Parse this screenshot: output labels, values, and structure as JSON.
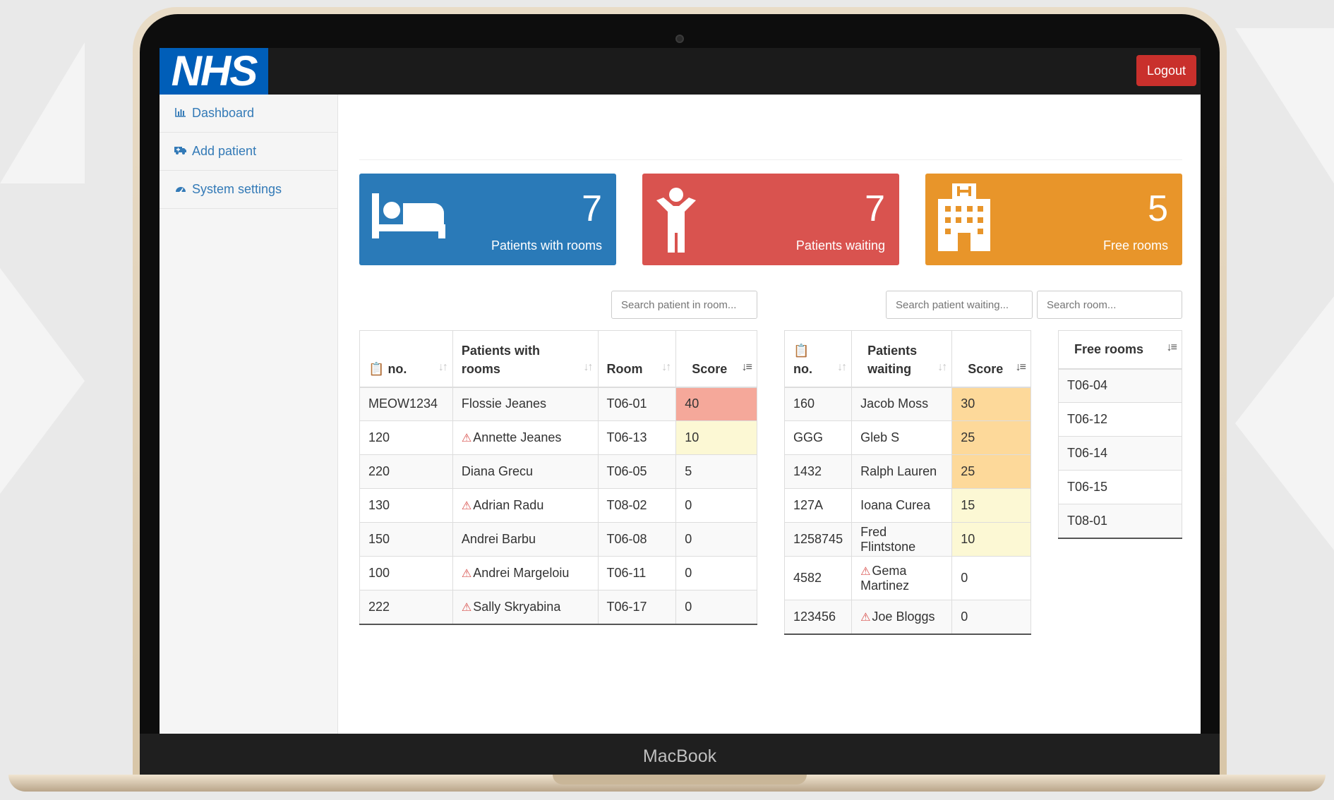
{
  "device": {
    "brand": "MacBook"
  },
  "header": {
    "logo": "NHS",
    "logout_label": "Logout"
  },
  "sidebar": {
    "items": [
      {
        "label": "Dashboard",
        "icon": "bar-chart-icon"
      },
      {
        "label": "Add patient",
        "icon": "ambulance-icon"
      },
      {
        "label": "System settings",
        "icon": "dashboard-gauge-icon"
      }
    ]
  },
  "cards": [
    {
      "value": "7",
      "label": "Patients with rooms",
      "color": "#2a7ab8",
      "icon": "bed-icon"
    },
    {
      "value": "7",
      "label": "Patients waiting",
      "color": "#d9534f",
      "icon": "person-icon"
    },
    {
      "value": "5",
      "label": "Free rooms",
      "color": "#e8952a",
      "icon": "hospital-icon"
    }
  ],
  "search": {
    "room_patients_placeholder": "Search patient in room...",
    "waiting_placeholder": "Search patient waiting...",
    "room_placeholder": "Search room..."
  },
  "rooms_table": {
    "headers": [
      "no.",
      "Patients with rooms",
      "Room",
      "Score"
    ],
    "rows": [
      {
        "no": "MEOW1234",
        "name": "Flossie Jeanes",
        "warn": false,
        "room": "T06-01",
        "score": "40"
      },
      {
        "no": "120",
        "name": "Annette Jeanes",
        "warn": true,
        "room": "T06-13",
        "score": "10"
      },
      {
        "no": "220",
        "name": "Diana Grecu",
        "warn": false,
        "room": "T06-05",
        "score": "5"
      },
      {
        "no": "130",
        "name": "Adrian Radu",
        "warn": true,
        "room": "T08-02",
        "score": "0"
      },
      {
        "no": "150",
        "name": "Andrei Barbu",
        "warn": false,
        "room": "T06-08",
        "score": "0"
      },
      {
        "no": "100",
        "name": "Andrei Margeloiu",
        "warn": true,
        "room": "T06-11",
        "score": "0"
      },
      {
        "no": "222",
        "name": "Sally Skryabina",
        "warn": true,
        "room": "T06-17",
        "score": "0"
      }
    ]
  },
  "waiting_table": {
    "headers": [
      "no.",
      "Patients waiting",
      "Score"
    ],
    "rows": [
      {
        "no": "160",
        "name": "Jacob Moss",
        "warn": false,
        "score": "30"
      },
      {
        "no": "GGG",
        "name": "Gleb S",
        "warn": false,
        "score": "25"
      },
      {
        "no": "1432",
        "name": "Ralph Lauren",
        "warn": false,
        "score": "25"
      },
      {
        "no": "127A",
        "name": "Ioana Curea",
        "warn": false,
        "score": "15"
      },
      {
        "no": "1258745",
        "name": "Fred Flintstone",
        "warn": false,
        "score": "10"
      },
      {
        "no": "4582",
        "name": "Gema Martinez",
        "warn": true,
        "score": "0"
      },
      {
        "no": "123456",
        "name": "Joe Bloggs",
        "warn": true,
        "score": "0"
      }
    ]
  },
  "free_rooms_table": {
    "header": "Free rooms",
    "rows": [
      "T06-04",
      "T06-12",
      "T06-14",
      "T06-15",
      "T08-01"
    ]
  },
  "score_colors": {
    "high": "#f5a89a",
    "medium": "#fdd99a",
    "low": "#fcf8d4"
  }
}
